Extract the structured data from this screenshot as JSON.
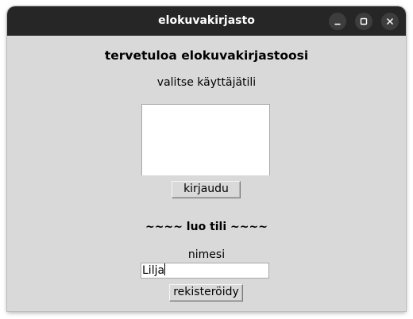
{
  "window": {
    "title": "elokuvakirjasto",
    "controls": {
      "minimize_icon": "minimize-icon",
      "maximize_icon": "maximize-icon",
      "close_icon": "close-icon"
    },
    "colors": {
      "titlebar": "#262626",
      "background": "#d9d9d9"
    }
  },
  "main": {
    "heading": "tervetuloa elokuvakirjastoosi",
    "select_account_label": "valitse käyttäjätili",
    "accounts": [],
    "login_button": "kirjaudu"
  },
  "register": {
    "section_title": "~~~~ luo tili ~~~~",
    "name_label": "nimesi",
    "name_value": "Lilja",
    "register_button": "rekisteröidy"
  }
}
